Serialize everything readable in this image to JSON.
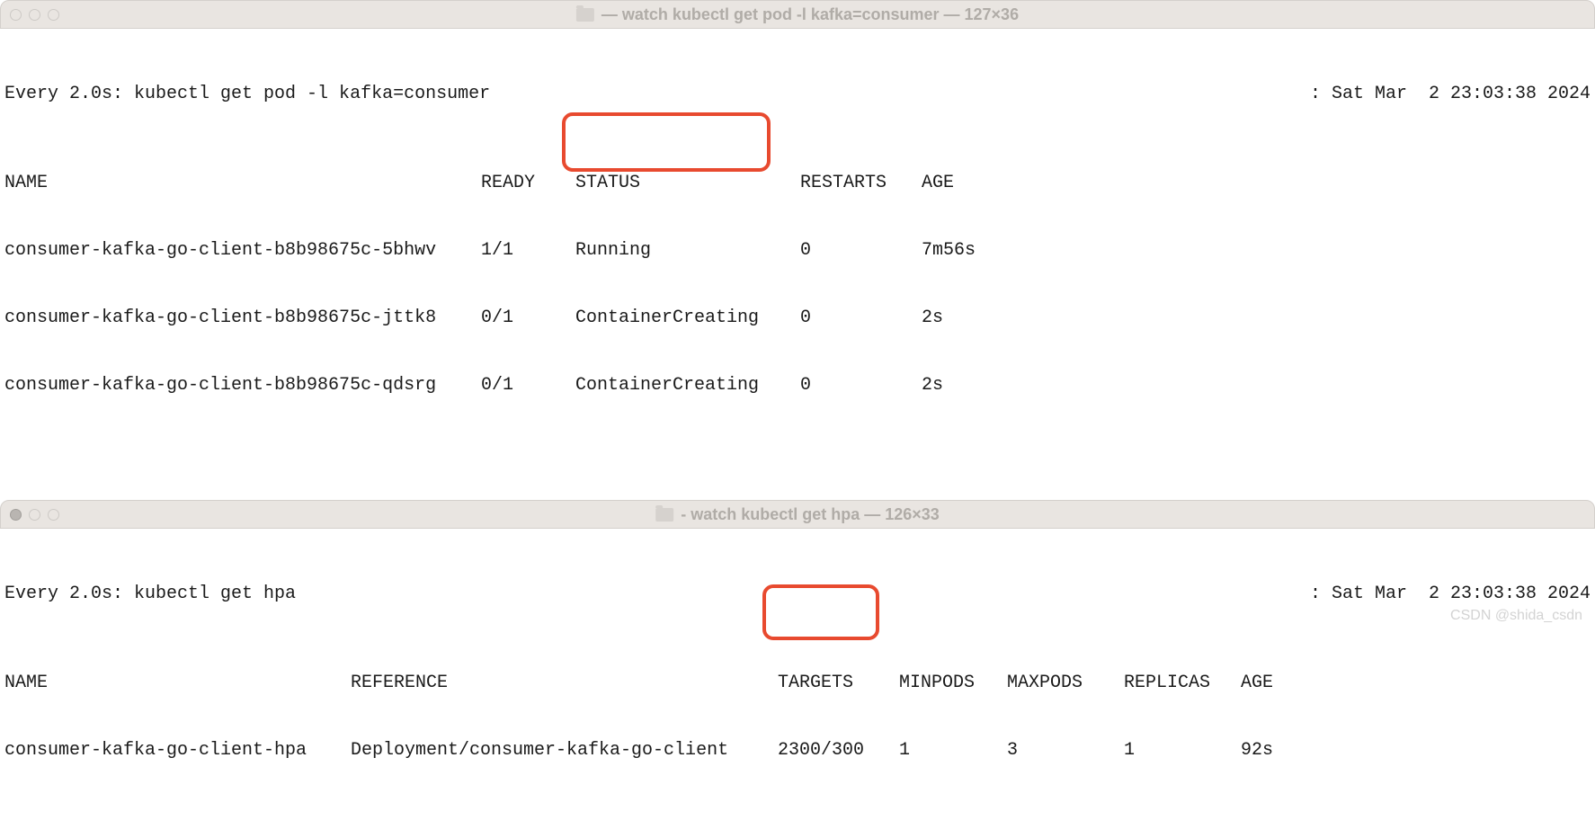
{
  "window1": {
    "title": "— watch kubectl get pod -l kafka=consumer — 127×36",
    "watch_prefix": "Every 2.0s: kubectl get pod -l kafka=consumer",
    "timestamp": ": Sat Mar  2 23:03:38 2024",
    "headers": {
      "name": "NAME",
      "ready": "READY",
      "status": "STATUS",
      "restarts": "RESTARTS",
      "age": "AGE"
    },
    "rows": [
      {
        "name": "consumer-kafka-go-client-b8b98675c-5bhwv",
        "ready": "1/1",
        "status": "Running",
        "restarts": "0",
        "age": "7m56s"
      },
      {
        "name": "consumer-kafka-go-client-b8b98675c-jttk8",
        "ready": "0/1",
        "status": "ContainerCreating",
        "restarts": "0",
        "age": "2s"
      },
      {
        "name": "consumer-kafka-go-client-b8b98675c-qdsrg",
        "ready": "0/1",
        "status": "ContainerCreating",
        "restarts": "0",
        "age": "2s"
      }
    ]
  },
  "window2": {
    "title": "- watch kubectl get hpa — 126×33",
    "watch_prefix": "Every 2.0s: kubectl get hpa",
    "timestamp": ": Sat Mar  2 23:03:38 2024",
    "headers": {
      "name": "NAME",
      "reference": "REFERENCE",
      "targets": "TARGETS",
      "minpods": "MINPODS",
      "maxpods": "MAXPODS",
      "replicas": "REPLICAS",
      "age": "AGE"
    },
    "rows": [
      {
        "name": "consumer-kafka-go-client-hpa",
        "reference": "Deployment/consumer-kafka-go-client",
        "targets": "2300/300",
        "minpods": "1",
        "maxpods": "3",
        "replicas": "1",
        "age": "92s"
      }
    ]
  },
  "watermark": "CSDN @shida_csdn"
}
